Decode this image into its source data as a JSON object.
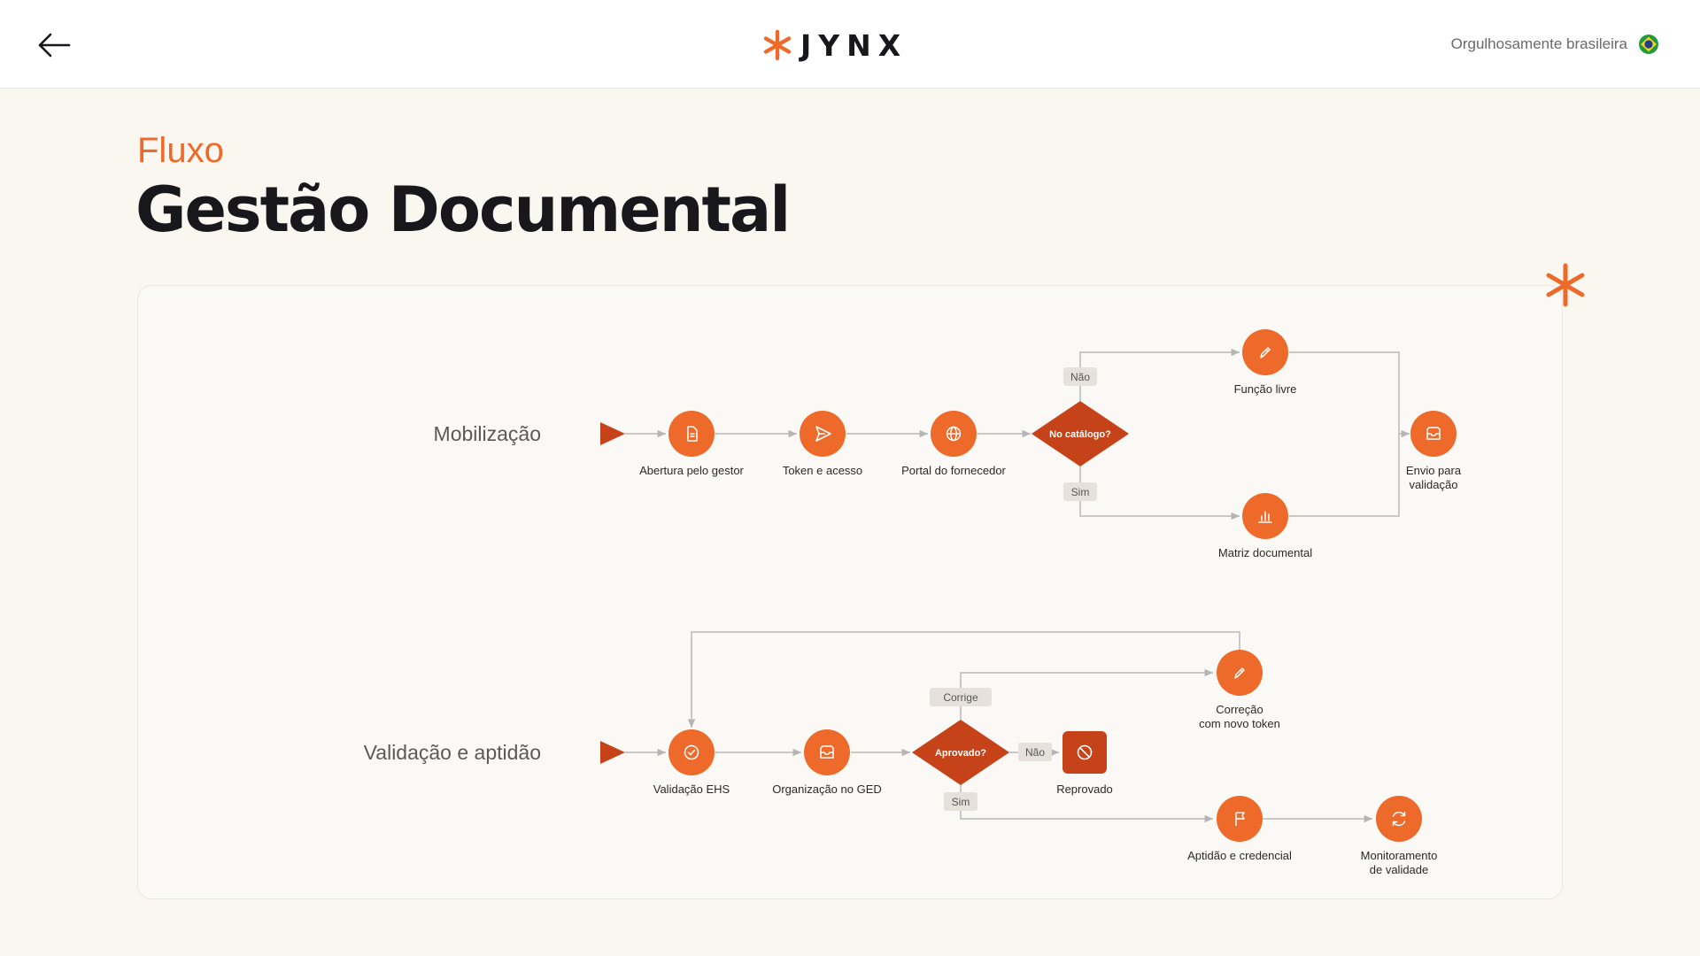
{
  "header": {
    "brand": "JYNX",
    "locale_text": "Orgulhosamente brasileira",
    "colors": {
      "accent": "#ee6a2b",
      "dark_accent": "#c64319",
      "text": "#17171c"
    }
  },
  "page": {
    "eyebrow": "Fluxo",
    "title": "Gestão Documental"
  },
  "diagram": {
    "lanes": [
      {
        "label": "Mobilização",
        "nodes": [
          {
            "label": "Abertura pelo gestor",
            "icon": "document-icon"
          },
          {
            "label": "Token e acesso",
            "icon": "send-icon"
          },
          {
            "label": "Portal do fornecedor",
            "icon": "globe-icon"
          },
          {
            "label": "No catálogo?",
            "icon": "decision"
          },
          {
            "label": "Função livre",
            "icon": "pencil-icon"
          },
          {
            "label": "Matriz documental",
            "icon": "bar-chart-icon"
          },
          {
            "label_lines": [
              "Envio para",
              "validação"
            ],
            "icon": "inbox-icon"
          }
        ],
        "edge_labels": {
          "no": "Não",
          "yes": "Sim"
        }
      },
      {
        "label": "Validação e aptidão",
        "nodes": [
          {
            "label": "Validação EHS",
            "icon": "check-circle-icon"
          },
          {
            "label": "Organização no GED",
            "icon": "inbox-icon"
          },
          {
            "label": "Aprovado?",
            "icon": "decision"
          },
          {
            "label_lines": [
              "Correção",
              "com novo token"
            ],
            "icon": "pencil-icon"
          },
          {
            "label": "Reprovado",
            "icon": "block-icon"
          },
          {
            "label": "Aptidão e credencial",
            "icon": "flag-icon"
          },
          {
            "label_lines": [
              "Monitoramento",
              "de validade"
            ],
            "icon": "refresh-icon"
          }
        ],
        "edge_labels": {
          "fix": "Corrige",
          "no": "Não",
          "yes": "Sim"
        }
      }
    ]
  }
}
